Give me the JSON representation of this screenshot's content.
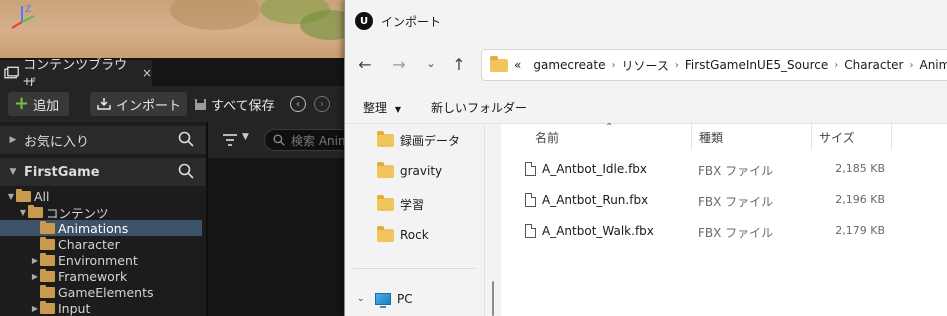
{
  "ue": {
    "tab_label": "コンテンツブラウザ",
    "tab_close": "×",
    "toolbar": {
      "add_label": "追加",
      "import_label": "インポート",
      "save_all_label": "すべて保存"
    },
    "favorites_label": "お気に入り",
    "project_label": "FirstGame",
    "search_placeholder": "検索 Anim",
    "axis": {
      "z": "Z",
      "y": "Y",
      "x": "X"
    },
    "tree": [
      {
        "label": "All",
        "depth": 0,
        "expanded": true,
        "selected": false
      },
      {
        "label": "コンテンツ",
        "depth": 1,
        "expanded": true,
        "selected": false
      },
      {
        "label": "Animations",
        "depth": 2,
        "expanded": false,
        "selected": true
      },
      {
        "label": "Character",
        "depth": 2,
        "expanded": false,
        "selected": false
      },
      {
        "label": "Environment",
        "depth": 2,
        "expanded": false,
        "selected": false,
        "has_children": true
      },
      {
        "label": "Framework",
        "depth": 2,
        "expanded": false,
        "selected": false,
        "has_children": true
      },
      {
        "label": "GameElements",
        "depth": 2,
        "expanded": false,
        "selected": false
      },
      {
        "label": "Input",
        "depth": 2,
        "expanded": false,
        "selected": false,
        "has_children": true
      }
    ],
    "colors": {
      "panel": "#1c1c1c",
      "selected": "#3e5368",
      "folder": "#c99a4e",
      "add_plus": "#6fc23a"
    }
  },
  "dialog": {
    "title": "インポート",
    "logo_icon": "unreal-logo-icon",
    "breadcrumbs": [
      "«",
      "gamecreate",
      "リソース",
      "FirstGameInUE5_Source",
      "Character",
      "Animation"
    ],
    "commands": {
      "organize": "整理",
      "new_folder": "新しいフォルダー"
    },
    "nav_items": [
      {
        "label": "録画データ",
        "icon": "folder-icon"
      },
      {
        "label": "gravity",
        "icon": "folder-icon"
      },
      {
        "label": "学習",
        "icon": "folder-icon"
      },
      {
        "label": "Rock",
        "icon": "folder-icon"
      }
    ],
    "pc_label": "PC",
    "columns": {
      "name": "名前",
      "type": "種類",
      "size": "サイズ"
    },
    "files": [
      {
        "name": "A_Antbot_Idle.fbx",
        "type": "FBX ファイル",
        "size": "2,185 KB"
      },
      {
        "name": "A_Antbot_Run.fbx",
        "type": "FBX ファイル",
        "size": "2,196 KB"
      },
      {
        "name": "A_Antbot_Walk.fbx",
        "type": "FBX ファイル",
        "size": "2,179 KB"
      }
    ],
    "colors": {
      "folder": "#f2c55c",
      "background": "#f3f3f3",
      "file_area": "#ffffff"
    }
  }
}
